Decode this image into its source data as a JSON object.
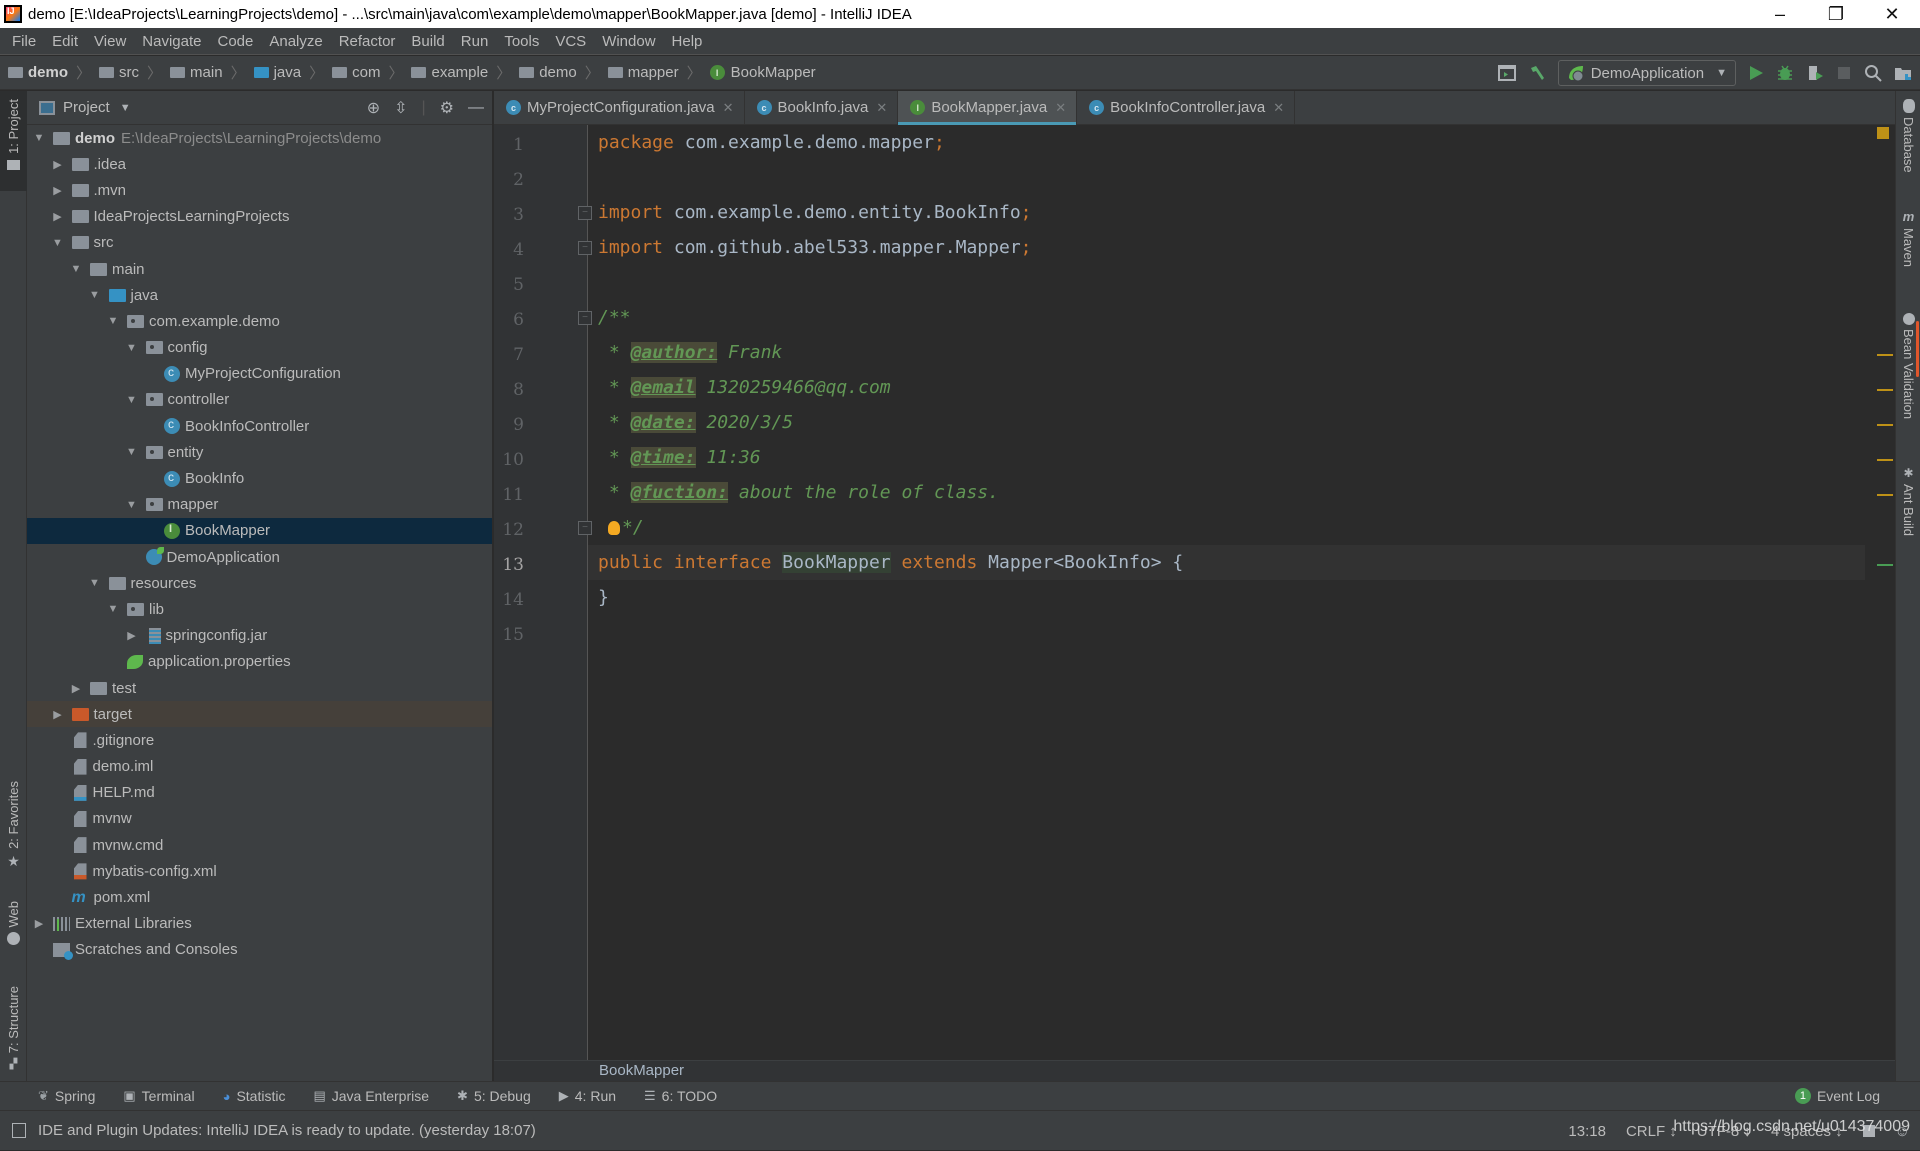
{
  "window": {
    "title": "demo [E:\\IdeaProjects\\LearningProjects\\demo] - ...\\src\\main\\java\\com\\example\\demo\\mapper\\BookMapper.java [demo] - IntelliJ IDEA",
    "minimize": "–",
    "restore": "❐",
    "close": "✕"
  },
  "menu": [
    "File",
    "Edit",
    "View",
    "Navigate",
    "Code",
    "Analyze",
    "Refactor",
    "Build",
    "Run",
    "Tools",
    "VCS",
    "Window",
    "Help"
  ],
  "breadcrumbs": [
    {
      "label": "demo",
      "icon": "module-folder-icon"
    },
    {
      "label": "src",
      "icon": "folder-icon"
    },
    {
      "label": "main",
      "icon": "folder-icon"
    },
    {
      "label": "java",
      "icon": "source-folder-icon"
    },
    {
      "label": "com",
      "icon": "package-icon"
    },
    {
      "label": "example",
      "icon": "package-icon"
    },
    {
      "label": "demo",
      "icon": "package-icon"
    },
    {
      "label": "mapper",
      "icon": "package-icon"
    },
    {
      "label": "BookMapper",
      "icon": "interface-icon"
    }
  ],
  "toolbar": {
    "run_config": "DemoApplication"
  },
  "project_panel": {
    "title": "Project",
    "tree": [
      {
        "label": "demo",
        "path": "E:\\IdeaProjects\\LearningProjects\\demo",
        "depth": 0,
        "expanded": true,
        "icon": "module"
      },
      {
        "label": ".idea",
        "depth": 1,
        "expanded": false,
        "icon": "folder"
      },
      {
        "label": ".mvn",
        "depth": 1,
        "expanded": false,
        "icon": "folder"
      },
      {
        "label": "IdeaProjectsLearningProjects",
        "depth": 1,
        "expanded": false,
        "icon": "folder"
      },
      {
        "label": "src",
        "depth": 1,
        "expanded": true,
        "icon": "folder"
      },
      {
        "label": "main",
        "depth": 2,
        "expanded": true,
        "icon": "folder"
      },
      {
        "label": "java",
        "depth": 3,
        "expanded": true,
        "icon": "source-folder"
      },
      {
        "label": "com.example.demo",
        "depth": 4,
        "expanded": true,
        "icon": "package"
      },
      {
        "label": "config",
        "depth": 5,
        "expanded": true,
        "icon": "package"
      },
      {
        "label": "MyProjectConfiguration",
        "depth": 6,
        "icon": "class"
      },
      {
        "label": "controller",
        "depth": 5,
        "expanded": true,
        "icon": "package"
      },
      {
        "label": "BookInfoController",
        "depth": 6,
        "icon": "class"
      },
      {
        "label": "entity",
        "depth": 5,
        "expanded": true,
        "icon": "package"
      },
      {
        "label": "BookInfo",
        "depth": 6,
        "icon": "class"
      },
      {
        "label": "mapper",
        "depth": 5,
        "expanded": true,
        "icon": "package"
      },
      {
        "label": "BookMapper",
        "depth": 6,
        "icon": "interface",
        "selected": true
      },
      {
        "label": "DemoApplication",
        "depth": 5,
        "icon": "spring-class"
      },
      {
        "label": "resources",
        "depth": 3,
        "expanded": true,
        "icon": "resources-folder"
      },
      {
        "label": "lib",
        "depth": 4,
        "expanded": true,
        "icon": "package"
      },
      {
        "label": "springconfig.jar",
        "depth": 5,
        "expanded": false,
        "icon": "jar"
      },
      {
        "label": "application.properties",
        "depth": 4,
        "icon": "spring-properties"
      },
      {
        "label": "test",
        "depth": 2,
        "expanded": false,
        "icon": "folder"
      },
      {
        "label": "target",
        "depth": 1,
        "expanded": false,
        "icon": "excluded-folder",
        "excluded": true
      },
      {
        "label": ".gitignore",
        "depth": 1,
        "icon": "text-file"
      },
      {
        "label": "demo.iml",
        "depth": 1,
        "icon": "iml-file"
      },
      {
        "label": "HELP.md",
        "depth": 1,
        "icon": "md-file"
      },
      {
        "label": "mvnw",
        "depth": 1,
        "icon": "text-file"
      },
      {
        "label": "mvnw.cmd",
        "depth": 1,
        "icon": "text-file"
      },
      {
        "label": "mybatis-config.xml",
        "depth": 1,
        "icon": "xml-file"
      },
      {
        "label": "pom.xml",
        "depth": 1,
        "icon": "maven-file"
      },
      {
        "label": "External Libraries",
        "depth": 0,
        "expanded": false,
        "icon": "libraries"
      },
      {
        "label": "Scratches and Consoles",
        "depth": 0,
        "icon": "scratches"
      }
    ]
  },
  "tabs": [
    {
      "label": "MyProjectConfiguration.java",
      "icon": "class",
      "active": false
    },
    {
      "label": "BookInfo.java",
      "icon": "class",
      "active": false
    },
    {
      "label": "BookMapper.java",
      "icon": "interface",
      "active": true
    },
    {
      "label": "BookInfoController.java",
      "icon": "class",
      "active": false
    }
  ],
  "editor": {
    "current_line": 13,
    "lines": [
      {
        "n": "1"
      },
      {
        "n": "2"
      },
      {
        "n": "3"
      },
      {
        "n": "4"
      },
      {
        "n": "5"
      },
      {
        "n": "6"
      },
      {
        "n": "7"
      },
      {
        "n": "8"
      },
      {
        "n": "9"
      },
      {
        "n": "10"
      },
      {
        "n": "11"
      },
      {
        "n": "12"
      },
      {
        "n": "13"
      },
      {
        "n": "14"
      },
      {
        "n": "15"
      }
    ],
    "code": {
      "l1_kw": "package",
      "l1_rest": " com.example.demo.mapper",
      "l1_semi": ";",
      "l3_kw": "import",
      "l3_rest": " com.example.demo.entity.BookInfo",
      "l3_semi": ";",
      "l4_kw": "import",
      "l4_rest": " com.github.abel533.mapper.Mapper",
      "l4_semi": ";",
      "l6": "/**",
      "l7_star": " * ",
      "l7_tag": "@author:",
      "l7_val": " Frank",
      "l8_star": " * ",
      "l8_tag": "@email",
      "l8_val": " 1320259466@qq.com",
      "l9_star": " * ",
      "l9_tag": "@date:",
      "l9_val": " 2020/3/5",
      "l10_star": " * ",
      "l10_tag": "@time:",
      "l10_val": " 11:36",
      "l11_star": " * ",
      "l11_tag": "@fuction:",
      "l11_val": " about the role of class.",
      "l12": "*/",
      "l13_kw1": "public",
      "l13_kw2": "interface",
      "l13_name": "BookMapper",
      "l13_kw3": "extends",
      "l13_rest": " Mapper<BookInfo> {",
      "l14": "}"
    },
    "breadcrumb": "BookMapper"
  },
  "left_tool_tabs": [
    "1: Project",
    "2: Favorites",
    "Web",
    "7: Structure"
  ],
  "right_tool_tabs": [
    "Database",
    "Maven",
    "Bean Validation",
    "Ant Build"
  ],
  "bottom_tool_tabs": [
    {
      "label": "Spring",
      "icon": "spring-icon"
    },
    {
      "label": "Terminal",
      "icon": "terminal-icon"
    },
    {
      "label": "Statistic",
      "icon": "statistic-icon"
    },
    {
      "label": "Java Enterprise",
      "icon": "java-enterprise-icon"
    },
    {
      "label": "5: Debug",
      "icon": "debug-icon"
    },
    {
      "label": "4: Run",
      "icon": "run-icon"
    },
    {
      "label": "6: TODO",
      "icon": "todo-icon"
    }
  ],
  "event_log": {
    "count": "1",
    "label": "Event Log"
  },
  "status": {
    "message": "IDE and Plugin Updates: IntelliJ IDEA is ready to update. (yesterday 18:07)",
    "position": "13:18",
    "line_sep": "CRLF ↕",
    "encoding": "UTF-8 ↕",
    "indent": "4 spaces ↕"
  },
  "watermark": "https://blog.csdn.net/u014374009"
}
